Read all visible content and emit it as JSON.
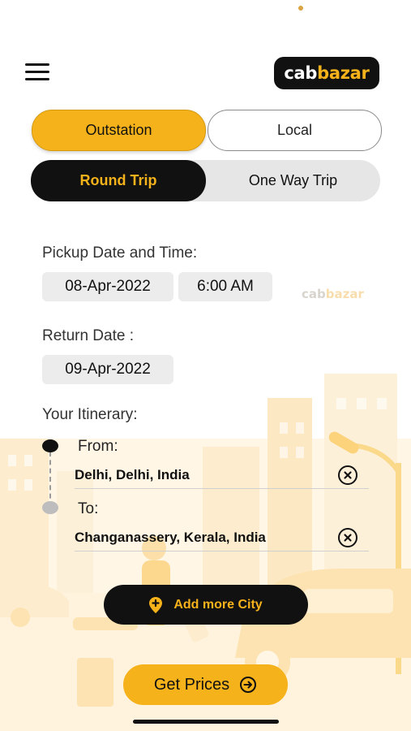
{
  "header": {
    "logo_part1": "cab",
    "logo_part2": "bazar"
  },
  "service_tabs": [
    {
      "label": "Outstation",
      "selected": true
    },
    {
      "label": "Local",
      "selected": false
    }
  ],
  "trip_tabs": [
    {
      "label": "Round Trip",
      "selected": true
    },
    {
      "label": "One Way Trip",
      "selected": false
    }
  ],
  "pickup": {
    "label": "Pickup Date and Time:",
    "date": "08-Apr-2022",
    "time": "6:00 AM"
  },
  "return_date": {
    "label": "Return Date :",
    "date": "09-Apr-2022"
  },
  "itinerary": {
    "label": "Your Itinerary:",
    "from_label": "From:",
    "from_value": "Delhi, Delhi, India",
    "to_label": "To:",
    "to_value": "Changanassery, Kerala, India"
  },
  "actions": {
    "add_city": "Add more City",
    "get_prices": "Get Prices"
  },
  "background_watermark_part1": "cab",
  "background_watermark_part2": "bazar",
  "colors": {
    "accent": "#f6b21a",
    "dark": "#111111",
    "chip_bg": "#ececec",
    "track_bg": "#e6e6e6"
  },
  "icons": [
    "hamburger-menu-icon",
    "close-circle-icon",
    "map-pin-plus-icon",
    "arrow-right-circle-icon"
  ]
}
